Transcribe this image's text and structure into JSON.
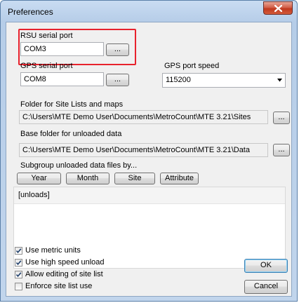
{
  "window": {
    "title": "Preferences"
  },
  "rsu": {
    "label": "RSU serial port",
    "value": "COM3",
    "browse": "..."
  },
  "gps": {
    "label": "GPS serial port",
    "value": "COM8",
    "browse": "...",
    "speed_label": "GPS port speed",
    "speed_value": "115200"
  },
  "folders": {
    "site_label": "Folder for Site Lists and maps",
    "site_path": "C:\\Users\\MTE Demo User\\Documents\\MetroCount\\MTE 3.21\\Sites",
    "site_browse": "...",
    "data_label": "Base folder for unloaded data",
    "data_path": "C:\\Users\\MTE Demo User\\Documents\\MetroCount\\MTE 3.21\\Data",
    "data_browse": "..."
  },
  "subgroup": {
    "label": "Subgroup unloaded data files by...",
    "buttons": [
      "Year",
      "Month",
      "Site",
      "Attribute"
    ],
    "pattern": "[unloads]"
  },
  "options": [
    {
      "label": "Use metric units",
      "checked": true
    },
    {
      "label": "Use high speed unload",
      "checked": true
    },
    {
      "label": "Allow editing of site list",
      "checked": true
    },
    {
      "label": "Enforce site list use",
      "checked": false
    }
  ],
  "actions": {
    "ok": "OK",
    "cancel": "Cancel"
  },
  "colors": {
    "highlight": "#e8222d",
    "close": "#c0391f"
  }
}
